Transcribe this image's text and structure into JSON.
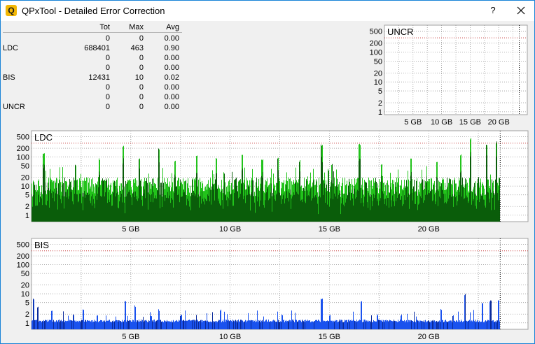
{
  "window": {
    "title": "QPxTool - Detailed Error Correction",
    "app_icon_glyph": "Q",
    "help_label": "?",
    "icons": {
      "close": "close-icon",
      "app": "qpxtool-app-icon"
    }
  },
  "stats": {
    "headers": {
      "label": "",
      "tot": "Tot",
      "max": "Max",
      "avg": "Avg"
    },
    "rows": [
      {
        "label": "",
        "tot": "0",
        "max": "0",
        "avg": "0.00"
      },
      {
        "label": "LDC",
        "tot": "688401",
        "max": "463",
        "avg": "0.90"
      },
      {
        "label": "",
        "tot": "0",
        "max": "0",
        "avg": "0.00"
      },
      {
        "label": "",
        "tot": "0",
        "max": "0",
        "avg": "0.00"
      },
      {
        "label": "BIS",
        "tot": "12431",
        "max": "10",
        "avg": "0.02"
      },
      {
        "label": "",
        "tot": "0",
        "max": "0",
        "avg": "0.00"
      },
      {
        "label": "",
        "tot": "0",
        "max": "0",
        "avg": "0.00"
      },
      {
        "label": "UNCR",
        "tot": "0",
        "max": "0",
        "avg": "0.00"
      }
    ]
  },
  "colors": {
    "ldc_bar": "#22c31b",
    "ldc_bar_dark": "#0a5d0a",
    "bis_bar": "#1a52ee",
    "bis_bar_dark": "#0a2a9a",
    "grid": "#9a9a9a",
    "threshold": "#c83c3c",
    "plot_bg": "#ffffff"
  },
  "chart_data": [
    {
      "type": "bar",
      "title": "UNCR",
      "yscale": "log",
      "ylim": [
        0.8,
        800
      ],
      "xlim": [
        0,
        25
      ],
      "yticks": [
        "500",
        "200",
        "100",
        "50",
        "20",
        "10",
        "5",
        "2",
        "1"
      ],
      "ytick_values": [
        500,
        200,
        100,
        50,
        20,
        10,
        5,
        2,
        1
      ],
      "xticks": [
        "5 GB",
        "10 GB",
        "15 GB",
        "20 GB"
      ],
      "xtick_values": [
        5,
        10,
        15,
        20
      ],
      "threshold": 300,
      "end": 23.6,
      "series": [
        {
          "x": [],
          "values": []
        }
      ]
    },
    {
      "type": "bar",
      "title": "LDC",
      "yscale": "log",
      "ylim": [
        0.6,
        800
      ],
      "xlim": [
        0,
        25
      ],
      "yticks": [
        "500",
        "200",
        "100",
        "50",
        "20",
        "10",
        "5",
        "2",
        "1"
      ],
      "ytick_values": [
        500,
        200,
        100,
        50,
        20,
        10,
        5,
        2,
        1
      ],
      "xticks": [
        "5 GB",
        "10 GB",
        "15 GB",
        "20 GB"
      ],
      "xtick_values": [
        5,
        10,
        15,
        20
      ],
      "threshold": 300,
      "end": 23.6,
      "baseline": 12,
      "peaks": [
        {
          "x": 0.6,
          "value": 150
        },
        {
          "x": 2.2,
          "value": 60
        },
        {
          "x": 3.4,
          "value": 90
        },
        {
          "x": 4.6,
          "value": 250
        },
        {
          "x": 5.4,
          "value": 90
        },
        {
          "x": 6.4,
          "value": 200
        },
        {
          "x": 7.2,
          "value": 80
        },
        {
          "x": 8.3,
          "value": 120
        },
        {
          "x": 9.3,
          "value": 100
        },
        {
          "x": 10.6,
          "value": 130
        },
        {
          "x": 11.6,
          "value": 90
        },
        {
          "x": 12.4,
          "value": 100
        },
        {
          "x": 13.5,
          "value": 80
        },
        {
          "x": 14.6,
          "value": 280
        },
        {
          "x": 15.1,
          "value": 60
        },
        {
          "x": 16.5,
          "value": 300
        },
        {
          "x": 17.6,
          "value": 60
        },
        {
          "x": 19.1,
          "value": 90
        },
        {
          "x": 20.4,
          "value": 70
        },
        {
          "x": 21.6,
          "value": 130
        },
        {
          "x": 22.1,
          "value": 463
        },
        {
          "x": 22.9,
          "value": 300
        },
        {
          "x": 23.4,
          "value": 350
        }
      ]
    },
    {
      "type": "bar",
      "title": "BIS",
      "yscale": "log",
      "ylim": [
        0.6,
        800
      ],
      "xlim": [
        0,
        25
      ],
      "yticks": [
        "500",
        "200",
        "100",
        "50",
        "20",
        "10",
        "5",
        "2",
        "1"
      ],
      "ytick_values": [
        500,
        200,
        100,
        50,
        20,
        10,
        5,
        2,
        1
      ],
      "xticks": [
        "5 GB",
        "10 GB",
        "15 GB",
        "20 GB"
      ],
      "xtick_values": [
        5,
        10,
        15,
        20
      ],
      "threshold": 300,
      "end": 23.6,
      "baseline": 1,
      "peaks": [
        {
          "x": 0.1,
          "value": 7
        },
        {
          "x": 0.3,
          "value": 4
        },
        {
          "x": 1.0,
          "value": 3
        },
        {
          "x": 2.1,
          "value": 2
        },
        {
          "x": 2.6,
          "value": 3
        },
        {
          "x": 3.3,
          "value": 2
        },
        {
          "x": 4.7,
          "value": 6
        },
        {
          "x": 5.2,
          "value": 4
        },
        {
          "x": 6.0,
          "value": 2
        },
        {
          "x": 6.4,
          "value": 3
        },
        {
          "x": 7.5,
          "value": 2
        },
        {
          "x": 9.5,
          "value": 3
        },
        {
          "x": 12.6,
          "value": 2
        },
        {
          "x": 14.6,
          "value": 7
        },
        {
          "x": 15.0,
          "value": 2
        },
        {
          "x": 16.6,
          "value": 6
        },
        {
          "x": 17.4,
          "value": 2
        },
        {
          "x": 18.6,
          "value": 2
        },
        {
          "x": 20.6,
          "value": 3
        },
        {
          "x": 21.2,
          "value": 2
        },
        {
          "x": 21.8,
          "value": 10
        },
        {
          "x": 22.7,
          "value": 5
        },
        {
          "x": 23.1,
          "value": 6
        },
        {
          "x": 23.5,
          "value": 6
        }
      ]
    }
  ]
}
